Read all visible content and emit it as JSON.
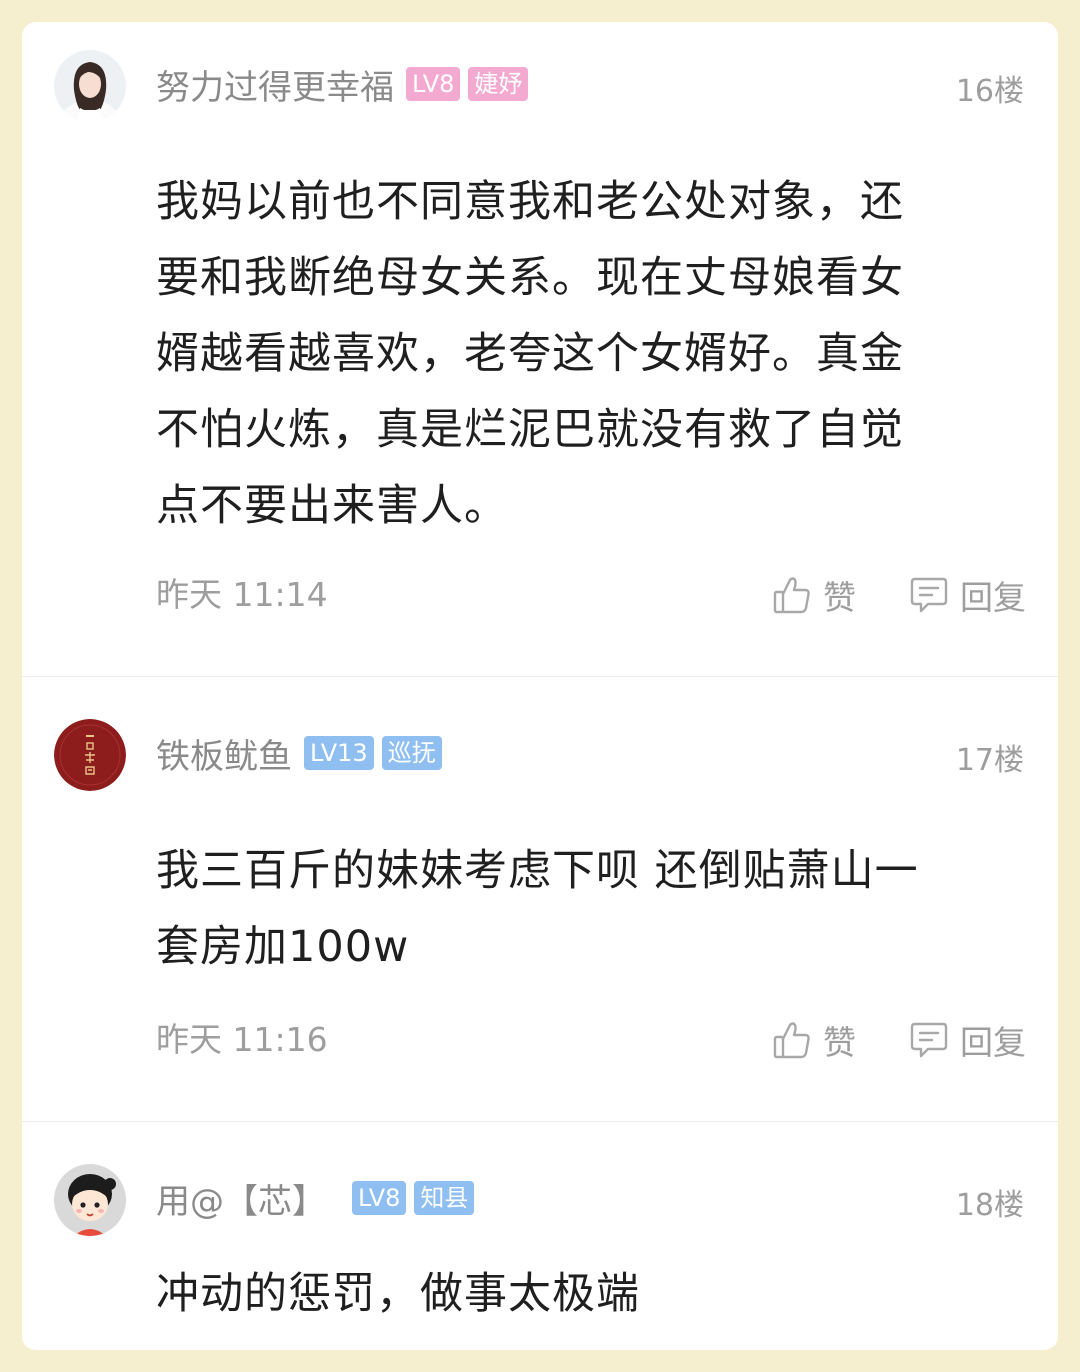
{
  "comments": [
    {
      "username": "努力过得更幸福",
      "level": "LV8",
      "title": "婕妤",
      "floor": "16楼",
      "lines": [
        "我妈以前也不同意我和老公处对象，还",
        "要和我断绝母女关系。现在丈母娘看女",
        "婿越看越喜欢，老夸这个女婿好。真金",
        "不怕火炼，真是烂泥巴就没有救了自觉",
        "点不要出来害人。"
      ],
      "time": "昨天 11:14",
      "like_label": "赞",
      "reply_label": "回复",
      "avatar_icon": "woman-avatar-icon"
    },
    {
      "username": "铁板鱿鱼",
      "level": "LV13",
      "title": "巡抚",
      "floor": "17楼",
      "lines": [
        "我三百斤的妹妹考虑下呗 还倒贴萧山一",
        "套房加100w"
      ],
      "time": "昨天 11:16",
      "like_label": "赞",
      "reply_label": "回复",
      "avatar_icon": "red-seal-avatar-icon"
    },
    {
      "username": "用@【芯】",
      "level": "LV8",
      "title": "知县",
      "floor": "18楼",
      "lines": [
        "冲动的惩罚，做事太极端"
      ],
      "avatar_icon": "cartoon-girl-avatar-icon"
    }
  ],
  "colors": {
    "page_background": "#f6efcf",
    "card_background": "#ffffff",
    "badge_pink": "#f4a9d0",
    "badge_blue": "#8fbef0",
    "meta_gray": "#9e9e9e",
    "text_dark": "#1f1f1f"
  }
}
